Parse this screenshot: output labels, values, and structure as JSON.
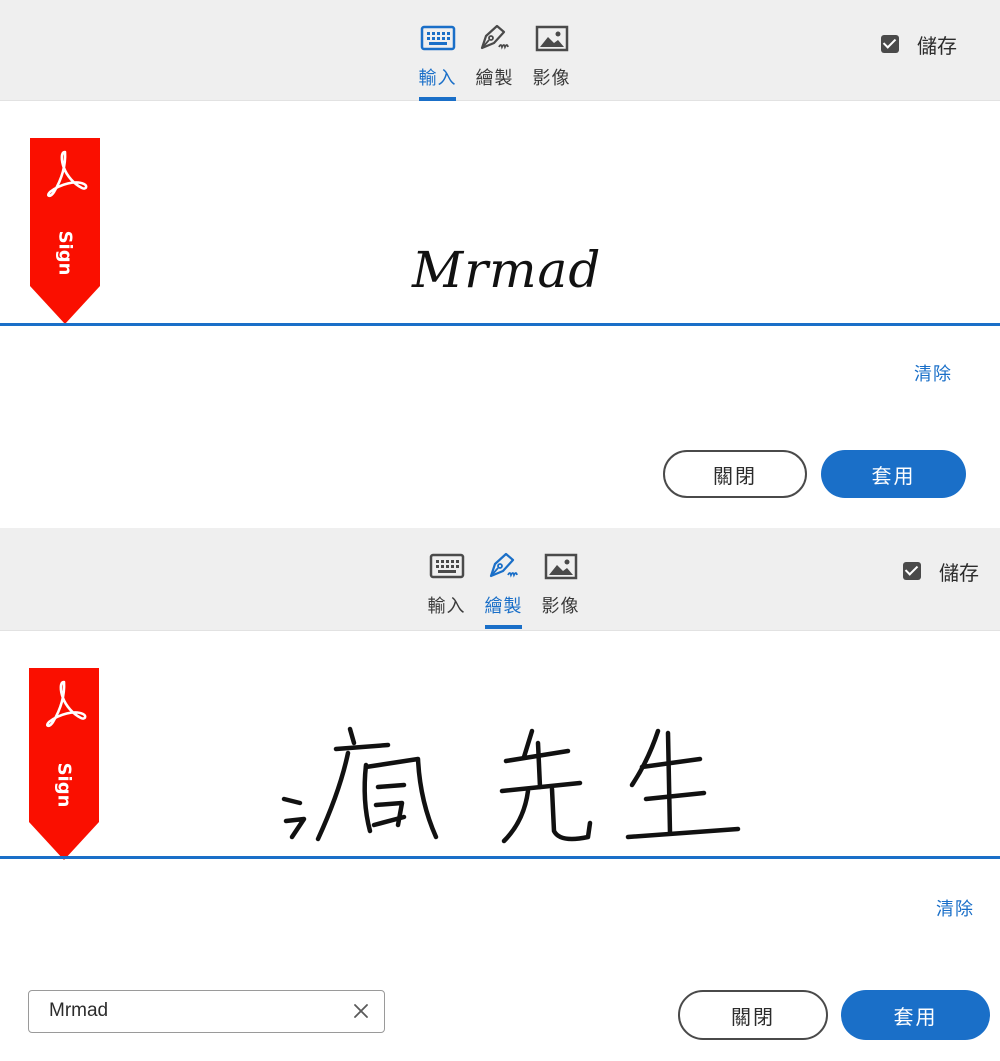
{
  "panel1": {
    "tabs": [
      {
        "label": "輸入",
        "icon": "keyboard-icon",
        "active": true
      },
      {
        "label": "繪製",
        "icon": "pen-draw-icon",
        "active": false
      },
      {
        "label": "影像",
        "icon": "image-icon",
        "active": false
      }
    ],
    "save_label": "儲存",
    "save_checked": true,
    "ribbon_text": "Sign",
    "signature_text": "Mrmad",
    "clear_label": "清除",
    "close_label": "關閉",
    "apply_label": "套用"
  },
  "panel2": {
    "tabs": [
      {
        "label": "輸入",
        "icon": "keyboard-icon",
        "active": false
      },
      {
        "label": "繪製",
        "icon": "pen-draw-icon",
        "active": true
      },
      {
        "label": "影像",
        "icon": "image-icon",
        "active": false
      }
    ],
    "save_label": "儲存",
    "save_checked": true,
    "ribbon_text": "Sign",
    "signature_drawn": "handwritten-signature",
    "clear_label": "清除",
    "name_field_value": "Mrmad",
    "close_label": "關閉",
    "apply_label": "套用"
  },
  "colors": {
    "accent": "#1a6fc8",
    "ribbon_red": "#fa0f00",
    "toolbar_bg": "#efefef"
  }
}
